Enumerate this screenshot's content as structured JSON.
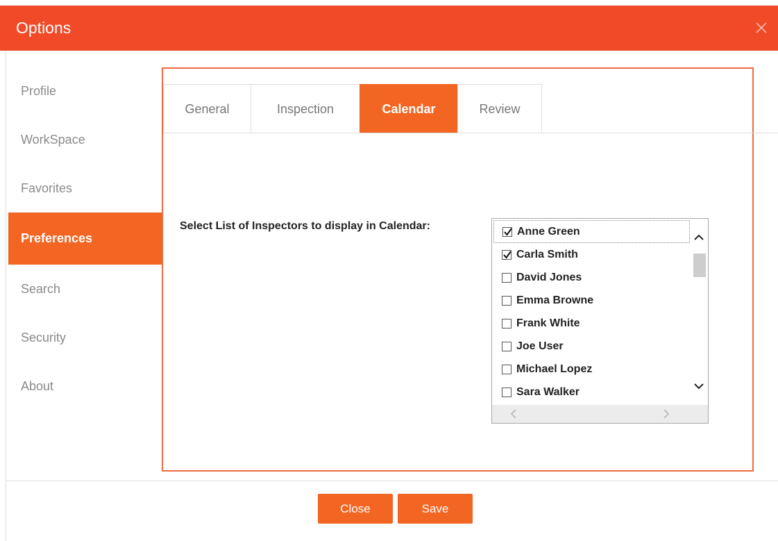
{
  "dialog": {
    "title": "Options",
    "accent_color": "#f04a28",
    "close_icon": "close-icon"
  },
  "sidebar": {
    "items": [
      {
        "label": "Profile",
        "active": false
      },
      {
        "label": "WorkSpace",
        "active": false
      },
      {
        "label": "Favorites",
        "active": false
      },
      {
        "label": "Preferences",
        "active": true
      },
      {
        "label": "Search",
        "active": false
      },
      {
        "label": "Security",
        "active": false
      },
      {
        "label": "About",
        "active": false
      }
    ]
  },
  "tabs": [
    {
      "label": "General",
      "active": false
    },
    {
      "label": "Inspection",
      "active": false
    },
    {
      "label": "Calendar",
      "active": true
    },
    {
      "label": "Review",
      "active": false
    }
  ],
  "calendar": {
    "field_label": "Select List of Inspectors to display in Calendar:",
    "inspectors": [
      {
        "name": "Anne Green",
        "checked": true
      },
      {
        "name": "Carla Smith",
        "checked": true
      },
      {
        "name": "David Jones",
        "checked": false
      },
      {
        "name": "Emma Browne",
        "checked": false
      },
      {
        "name": "Frank White",
        "checked": false
      },
      {
        "name": "Joe User",
        "checked": false
      },
      {
        "name": "Michael Lopez",
        "checked": false
      },
      {
        "name": "Sara Walker",
        "checked": false
      }
    ]
  },
  "footer": {
    "close_label": "Close",
    "save_label": "Save"
  }
}
